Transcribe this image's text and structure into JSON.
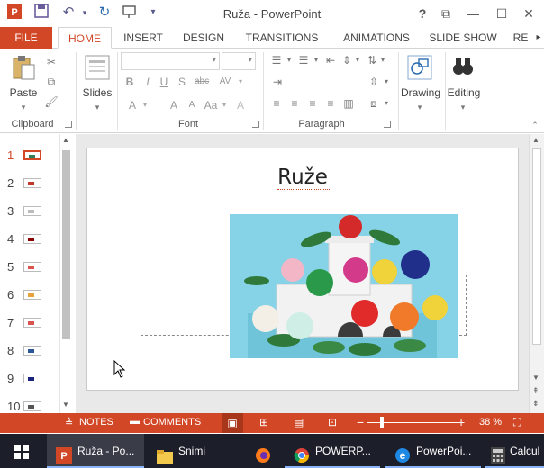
{
  "window": {
    "title": "Ruža - PowerPoint",
    "help": "?",
    "min": "—",
    "max": "☐",
    "close": "✕",
    "restore": "⧉"
  },
  "qat": {
    "save_icon": "save-icon",
    "undo_icon": "undo-icon",
    "redo_icon": "redo-icon",
    "present_icon": "present-icon",
    "customize_icon": "chevron-down-icon"
  },
  "tabs": [
    "FILE",
    "HOME",
    "INSERT",
    "DESIGN",
    "TRANSITIONS",
    "ANIMATIONS",
    "SLIDE SHOW",
    "RE"
  ],
  "ribbon": {
    "clipboard": {
      "paste": "Paste",
      "label": "Clipboard"
    },
    "slides": {
      "label": "Slides"
    },
    "font": {
      "label": "Font",
      "font_name": "",
      "font_size": ""
    },
    "paragraph": {
      "label": "Paragraph"
    },
    "drawing": {
      "label": "Drawing"
    },
    "editing": {
      "label": "Editing"
    }
  },
  "thumbnails": [
    {
      "num": "1",
      "color": "#2e7d5b"
    },
    {
      "num": "2",
      "color": "#c0392b"
    },
    {
      "num": "3",
      "color": "#bbbbbb"
    },
    {
      "num": "4",
      "color": "#8b0000"
    },
    {
      "num": "5",
      "color": "#d9534f"
    },
    {
      "num": "6",
      "color": "#e6a23c"
    },
    {
      "num": "7",
      "color": "#d9534f"
    },
    {
      "num": "8",
      "color": "#2b5797"
    },
    {
      "num": "9",
      "color": "#1a237e"
    },
    {
      "num": "10",
      "color": "#555555"
    }
  ],
  "slide": {
    "title": "Ruže"
  },
  "statusbar": {
    "notes": "NOTES",
    "comments": "COMMENTS",
    "zoom": "38 %",
    "zoom_level": 0.38
  },
  "taskbar": {
    "items": [
      {
        "label": "Ruža - Po...",
        "icon": "powerpoint-icon"
      },
      {
        "label": "Snimi",
        "icon": "folder-icon"
      },
      {
        "label": "",
        "icon": "firefox-icon"
      },
      {
        "label": "POWERP...",
        "icon": "chrome-icon"
      },
      {
        "label": "PowerPoi...",
        "icon": "edge-icon"
      },
      {
        "label": "Calcul",
        "icon": "calculator-icon"
      }
    ]
  },
  "colors": {
    "accent": "#d24726",
    "taskbar": "#1c1f2a",
    "slide_bg": "#7fd1e6"
  }
}
